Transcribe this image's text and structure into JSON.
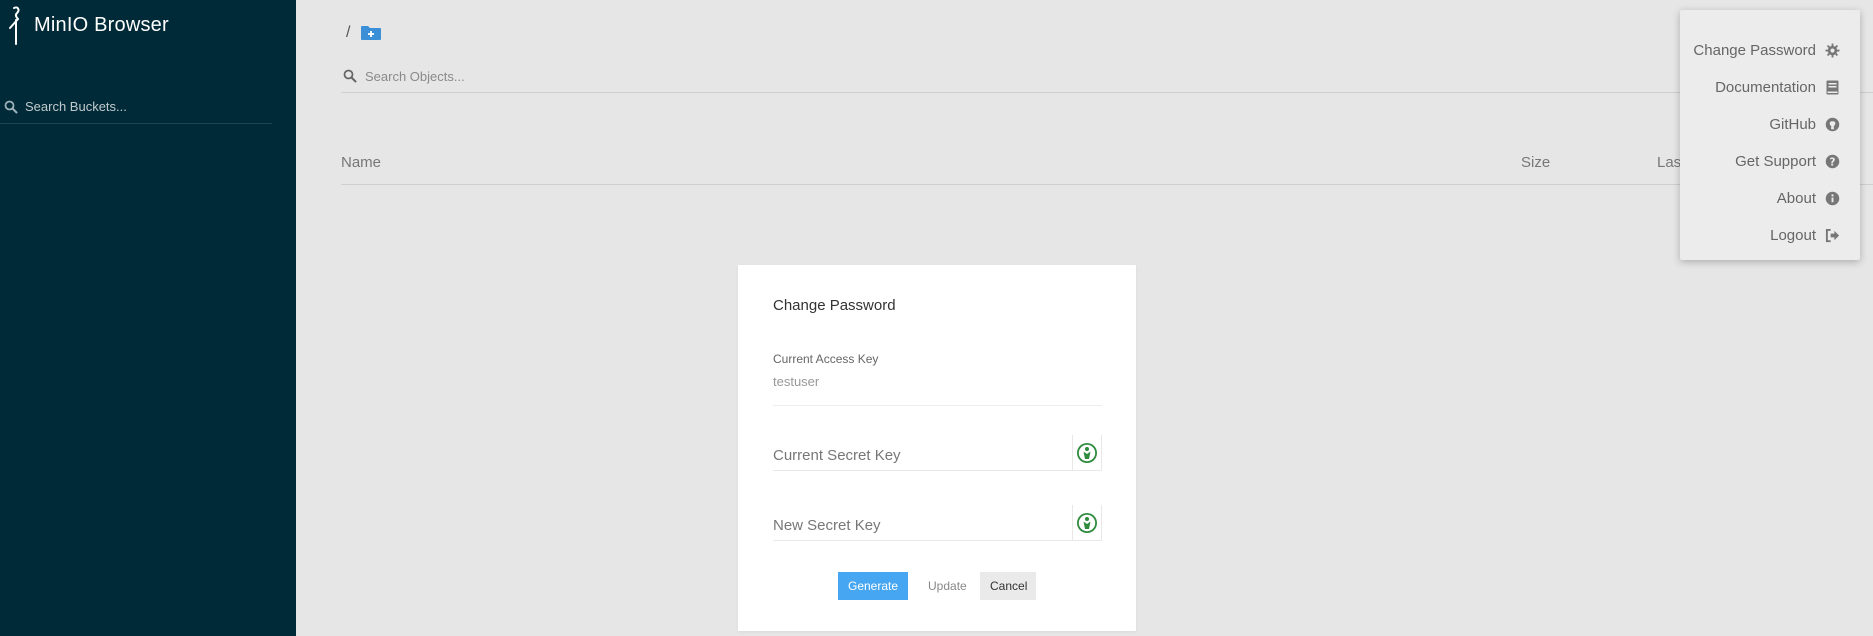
{
  "app": {
    "title": "MinIO Browser"
  },
  "sidebar": {
    "search_placeholder": "Search Buckets..."
  },
  "main": {
    "breadcrumb_separator": "/",
    "search_placeholder": "Search Objects...",
    "columns": {
      "name": "Name",
      "size": "Size",
      "last_modified": "Las"
    }
  },
  "menu": {
    "items": [
      {
        "label": "Change Password",
        "icon": "gear-icon"
      },
      {
        "label": "Documentation",
        "icon": "book-icon"
      },
      {
        "label": "GitHub",
        "icon": "github-icon"
      },
      {
        "label": "Get Support",
        "icon": "question-circle-icon"
      },
      {
        "label": "About",
        "icon": "info-circle-icon"
      },
      {
        "label": "Logout",
        "icon": "sign-out-icon"
      }
    ]
  },
  "modal": {
    "title": "Change Password",
    "access_key_label": "Current Access Key",
    "access_key_value": "testuser",
    "current_secret_placeholder": "Current Secret Key",
    "new_secret_placeholder": "New Secret Key",
    "buttons": {
      "generate": "Generate",
      "update": "Update",
      "cancel": "Cancel"
    }
  },
  "colors": {
    "sidebar_bg": "#002a37",
    "main_bg": "#e6e6e6",
    "accent": "#46a6f2",
    "eye_icon": "#2e8b3e"
  }
}
